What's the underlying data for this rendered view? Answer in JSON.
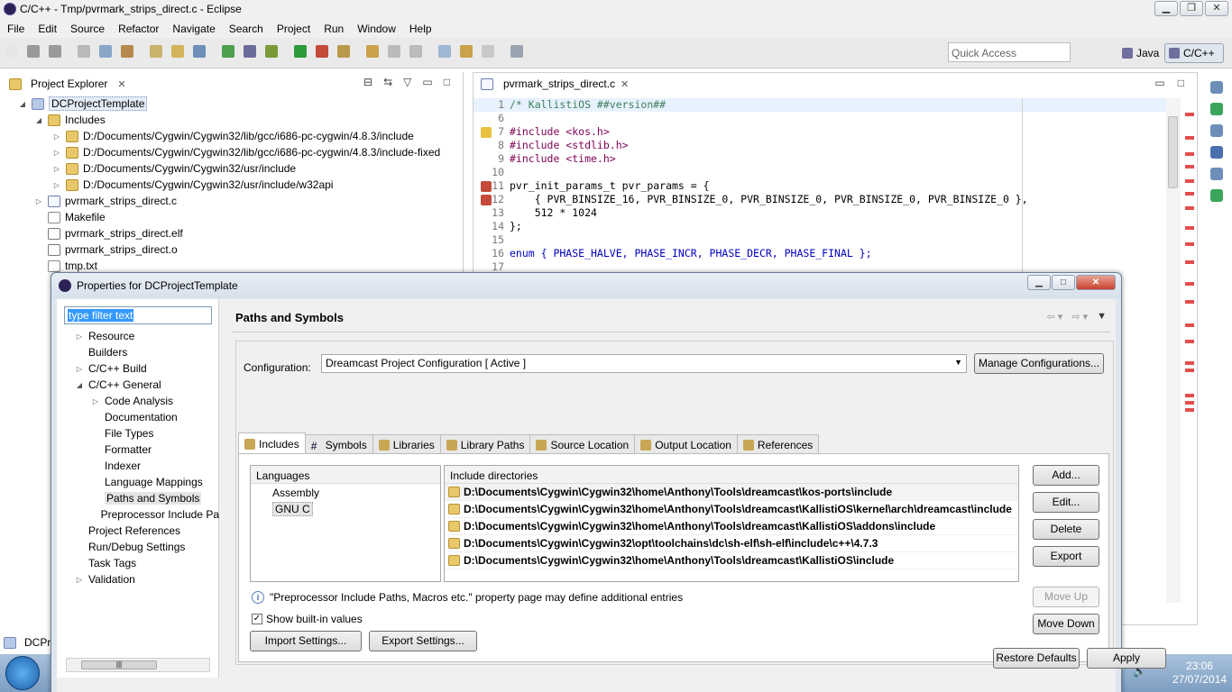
{
  "window": {
    "title": "C/C++ - Tmp/pvrmark_strips_direct.c - Eclipse"
  },
  "menu": [
    "File",
    "Edit",
    "Source",
    "Refactor",
    "Navigate",
    "Search",
    "Project",
    "Run",
    "Window",
    "Help"
  ],
  "toolbar": {
    "quick_access_placeholder": "Quick Access",
    "perspective_java": "Java",
    "perspective_cpp": "C/C++"
  },
  "project_explorer": {
    "tab_label": "Project Explorer",
    "project_name": "DCProjectTemplate",
    "includes_label": "Includes",
    "include_paths": [
      "D:/Documents/Cygwin/Cygwin32/lib/gcc/i686-pc-cygwin/4.8.3/include",
      "D:/Documents/Cygwin/Cygwin32/lib/gcc/i686-pc-cygwin/4.8.3/include-fixed",
      "D:/Documents/Cygwin/Cygwin32/usr/include",
      "D:/Documents/Cygwin/Cygwin32/usr/include/w32api"
    ],
    "files": [
      "pvrmark_strips_direct.c",
      "Makefile",
      "pvrmark_strips_direct.elf",
      "pvrmark_strips_direct.o",
      "tmp.txt"
    ]
  },
  "editor": {
    "tab_label": "pvrmark_strips_direct.c",
    "lines": [
      {
        "n": "1",
        "text": "/* KallistiOS ##version##"
      },
      {
        "n": "6",
        "text": ""
      },
      {
        "n": "7",
        "text": "#include <kos.h>"
      },
      {
        "n": "8",
        "text": "#include <stdlib.h>"
      },
      {
        "n": "9",
        "text": "#include <time.h>"
      },
      {
        "n": "10",
        "text": ""
      },
      {
        "n": "11",
        "text": "pvr_init_params_t pvr_params = {"
      },
      {
        "n": "12",
        "text": "    { PVR_BINSIZE_16, PVR_BINSIZE_0, PVR_BINSIZE_0, PVR_BINSIZE_0, PVR_BINSIZE_0 },"
      },
      {
        "n": "13",
        "text": "    512 * 1024"
      },
      {
        "n": "14",
        "text": "};"
      },
      {
        "n": "15",
        "text": ""
      },
      {
        "n": "16",
        "text": "enum { PHASE_HALVE, PHASE_INCR, PHASE_DECR, PHASE_FINAL };"
      },
      {
        "n": "17",
        "text": ""
      }
    ]
  },
  "dialog": {
    "title": "Properties for DCProjectTemplate",
    "filter_text": "type filter text",
    "nav": [
      {
        "label": "Resource",
        "indent": 1,
        "twisty": "▷"
      },
      {
        "label": "Builders",
        "indent": 1,
        "twisty": ""
      },
      {
        "label": "C/C++ Build",
        "indent": 1,
        "twisty": "▷"
      },
      {
        "label": "C/C++ General",
        "indent": 1,
        "twisty": "◢"
      },
      {
        "label": "Code Analysis",
        "indent": 2,
        "twisty": "▷"
      },
      {
        "label": "Documentation",
        "indent": 2,
        "twisty": ""
      },
      {
        "label": "File Types",
        "indent": 2,
        "twisty": ""
      },
      {
        "label": "Formatter",
        "indent": 2,
        "twisty": ""
      },
      {
        "label": "Indexer",
        "indent": 2,
        "twisty": ""
      },
      {
        "label": "Language Mappings",
        "indent": 2,
        "twisty": ""
      },
      {
        "label": "Paths and Symbols",
        "indent": 2,
        "twisty": ""
      },
      {
        "label": "Preprocessor Include Pa",
        "indent": 2,
        "twisty": ""
      },
      {
        "label": "Project References",
        "indent": 1,
        "twisty": ""
      },
      {
        "label": "Run/Debug Settings",
        "indent": 1,
        "twisty": ""
      },
      {
        "label": "Task Tags",
        "indent": 1,
        "twisty": ""
      },
      {
        "label": "Validation",
        "indent": 1,
        "twisty": "▷"
      }
    ],
    "selected_nav": "Paths and Symbols",
    "page_title": "Paths and Symbols",
    "configuration_label": "Configuration:",
    "configuration_value": "Dreamcast Project Configuration  [ Active ]",
    "manage_configurations": "Manage Configurations...",
    "tabs": [
      "Includes",
      "Symbols",
      "Libraries",
      "Library Paths",
      "Source Location",
      "Output Location",
      "References"
    ],
    "active_tab": "Includes",
    "languages_header": "Languages",
    "languages": [
      "Assembly",
      "GNU C"
    ],
    "selected_language": "GNU C",
    "include_dirs_header": "Include directories",
    "include_dirs": [
      "D:\\Documents\\Cygwin\\Cygwin32\\home\\Anthony\\Tools\\dreamcast\\kos-ports\\include",
      "D:\\Documents\\Cygwin\\Cygwin32\\home\\Anthony\\Tools\\dreamcast\\KallistiOS\\kernel\\arch\\dreamcast\\include",
      "D:\\Documents\\Cygwin\\Cygwin32\\home\\Anthony\\Tools\\dreamcast\\KallistiOS\\addons\\include",
      "D:\\Documents\\Cygwin\\Cygwin32\\opt\\toolchains\\dc\\sh-elf\\sh-elf\\include\\c++\\4.7.3",
      "D:\\Documents\\Cygwin\\Cygwin32\\home\\Anthony\\Tools\\dreamcast\\KallistiOS\\include"
    ],
    "buttons": {
      "add": "Add...",
      "edit": "Edit...",
      "delete": "Delete",
      "export": "Export",
      "move_up": "Move Up",
      "move_down": "Move Down"
    },
    "info_text": "\"Preprocessor Include Paths, Macros etc.\" property page may define additional entries",
    "show_builtin": "Show built-in values",
    "import_settings": "Import Settings...",
    "export_settings": "Export Settings...",
    "restore_defaults": "Restore Defaults",
    "apply": "Apply"
  },
  "taskbar": {
    "time": "23:06",
    "date": "27/07/2014",
    "peek_label": "DCPro"
  }
}
